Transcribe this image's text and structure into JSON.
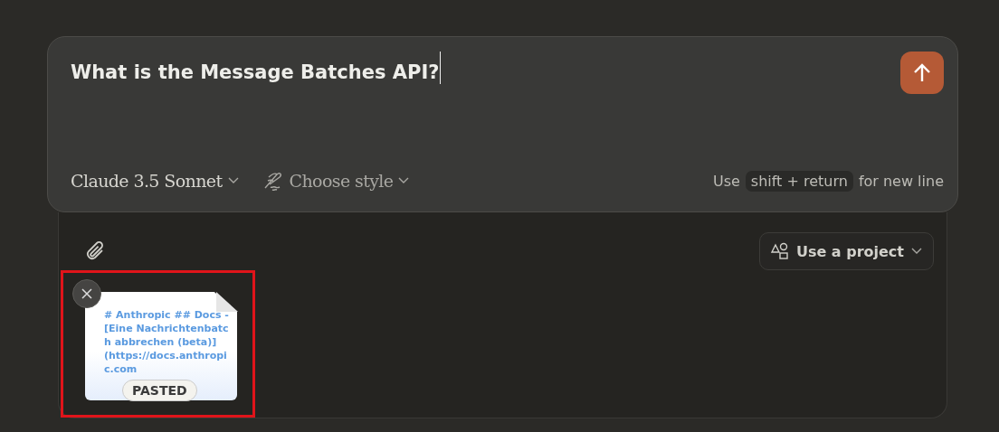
{
  "prompt": {
    "value": "What is the Message Batches API?"
  },
  "model_select": {
    "label": "Claude 3.5 Sonnet"
  },
  "style_select": {
    "label": "Choose style"
  },
  "hint": {
    "before": "Use",
    "key": "shift + return",
    "after": "for new line"
  },
  "project_button": {
    "label": "Use a project"
  },
  "attachments": [
    {
      "kind": "pasted",
      "preview": "# Anthropic ## Docs - [Eine Nachrichtenbatch abbrechen (beta)] (https://docs.anthropi c.com",
      "badge": "PASTED",
      "highlighted": true
    }
  ]
}
